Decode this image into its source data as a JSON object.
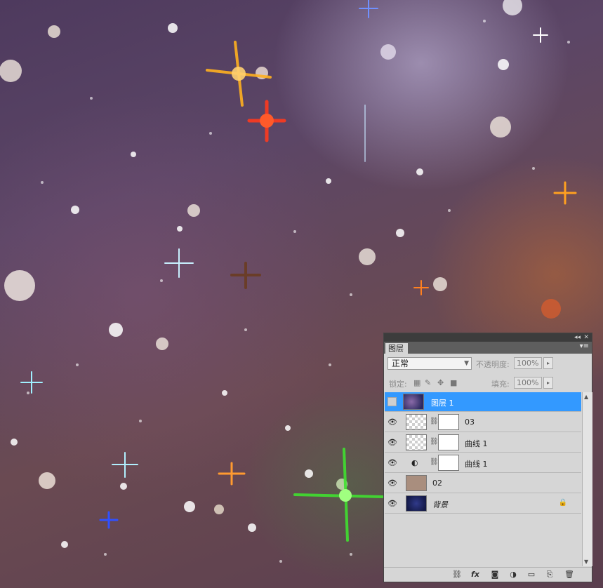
{
  "panel": {
    "tab_label": "图层",
    "blend_mode": "正常",
    "opacity_label": "不透明度:",
    "opacity_value": "100%",
    "lock_label": "锁定:",
    "fill_label": "填充:",
    "fill_value": "100%"
  },
  "layers": [
    {
      "name": "图层 1",
      "selected": true,
      "visible": false
    },
    {
      "name": "03",
      "selected": false,
      "visible": true
    },
    {
      "name": "曲线 1",
      "selected": false,
      "visible": true
    },
    {
      "name": "曲线 1",
      "selected": false,
      "visible": true
    },
    {
      "name": "02",
      "selected": false,
      "visible": true
    },
    {
      "name": "背景",
      "selected": false,
      "visible": true,
      "locked": true
    }
  ],
  "icons": {
    "eye": "eye-icon",
    "link": "link-icon",
    "fx": "fx-icon",
    "mask": "add-mask-icon",
    "adjustment": "adjustment-layer-icon",
    "group": "new-group-icon",
    "new_layer": "new-layer-icon",
    "trash": "trash-icon"
  },
  "bottom_fx_label": "fx"
}
